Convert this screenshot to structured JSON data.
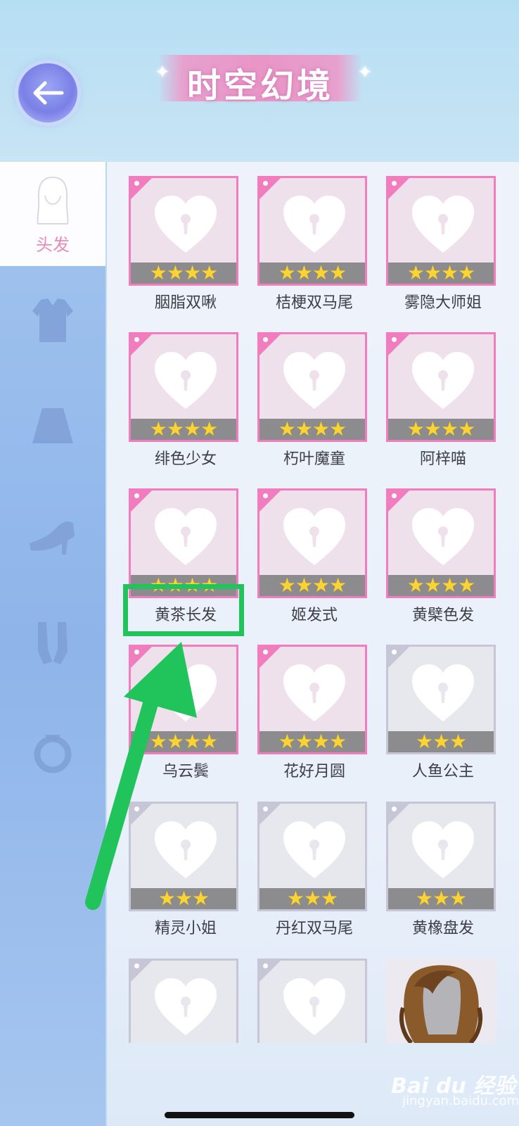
{
  "header": {
    "title": "时空幻境",
    "back_icon": "back-arrow-icon"
  },
  "sidebar": {
    "active_label": "头发",
    "items": [
      {
        "name": "hair",
        "icon": "hair-icon",
        "active": true
      },
      {
        "name": "top",
        "icon": "top-clothing-icon",
        "active": false
      },
      {
        "name": "skirt",
        "icon": "skirt-icon",
        "active": false
      },
      {
        "name": "shoes",
        "icon": "shoes-icon",
        "active": false
      },
      {
        "name": "socks",
        "icon": "socks-icon",
        "active": false
      },
      {
        "name": "accessory",
        "icon": "ring-icon",
        "active": false
      }
    ]
  },
  "grid": {
    "items": [
      {
        "name": "胭脂双啾",
        "stars": "★★★★",
        "rarity": "pink"
      },
      {
        "name": "桔梗双马尾",
        "stars": "★★★★",
        "rarity": "pink"
      },
      {
        "name": "雾隐大师姐",
        "stars": "★★★★",
        "rarity": "pink"
      },
      {
        "name": "绯色少女",
        "stars": "★★★★",
        "rarity": "pink"
      },
      {
        "name": "朽叶魔童",
        "stars": "★★★★",
        "rarity": "pink"
      },
      {
        "name": "阿梓喵",
        "stars": "★★★★",
        "rarity": "pink"
      },
      {
        "name": "黄茶长发",
        "stars": "★★★★",
        "rarity": "pink"
      },
      {
        "name": "姬发式",
        "stars": "★★★★",
        "rarity": "pink"
      },
      {
        "name": "黄檗色发",
        "stars": "★★★★",
        "rarity": "pink"
      },
      {
        "name": "乌云鬓",
        "stars": "★★★★",
        "rarity": "pink"
      },
      {
        "name": "花好月圆",
        "stars": "★★★★",
        "rarity": "pink"
      },
      {
        "name": "人鱼公主",
        "stars": "★★★",
        "rarity": "gray"
      },
      {
        "name": "精灵小姐",
        "stars": "★★★",
        "rarity": "gray"
      },
      {
        "name": "丹红双马尾",
        "stars": "★★★",
        "rarity": "gray"
      },
      {
        "name": "黄橡盘发",
        "stars": "★★★",
        "rarity": "gray"
      }
    ]
  },
  "annotation": {
    "highlight_color": "#21c35b",
    "highlighted_item": "黄茶长发"
  },
  "watermark": {
    "brand": "Bai du 经验",
    "url": "jingyan.baidu.com"
  },
  "colors": {
    "pink_border": "#f27dbe",
    "gray_border": "#c6c6d6",
    "star": "#f9d433",
    "accent_label": "#e98ab9"
  }
}
